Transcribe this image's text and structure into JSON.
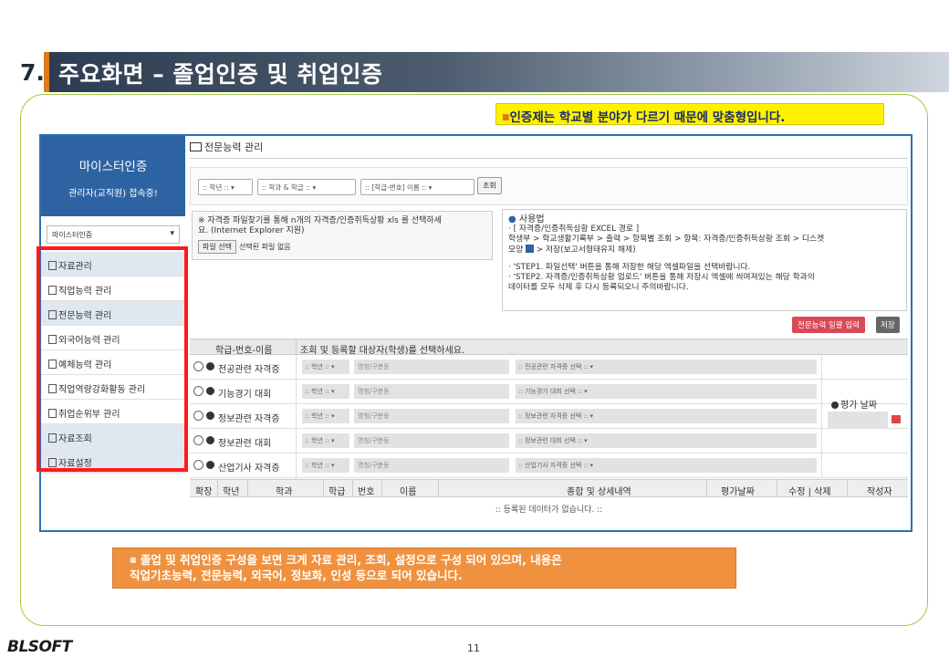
{
  "slide": {
    "number": "7.",
    "title": "주요화면 – 졸업인증 및 취업인증",
    "note_top": "인증제는 학교별 분야가 다르기 때문에 맞춤형입니다.",
    "note_bottom_line1": "졸업 및 취업인증 구성을 보면 크게 자료 관리, 조회, 설정으로 구성 되어 있으며, 내용은",
    "note_bottom_line2": "직업기초능력, 전문능력, 외국어, 정보화, 인성 등으로 되어 있습니다.",
    "logo_a": "BL",
    "logo_b": "SOFT",
    "page": "11"
  },
  "sidebar": {
    "title": "마이스터인증",
    "subtitle": "관리자(교직원) 접속중!",
    "select_value": "마이스터인증",
    "items": [
      {
        "label": "자료관리"
      },
      {
        "label": "직업능력 관리"
      },
      {
        "label": "전문능력 관리"
      },
      {
        "label": "외국어능력 관리"
      },
      {
        "label": "예체능력 관리"
      },
      {
        "label": "직업역량강화활동 관리"
      },
      {
        "label": "취업순위부 관리"
      },
      {
        "label": "자료조회"
      },
      {
        "label": "자료설정"
      }
    ]
  },
  "content": {
    "title": "전문능력 관리",
    "filter_year": ":: 학년 :: ▾",
    "filter_dept": ":: 학과 & 학급 ::  ▾",
    "filter_name": ":: [학급-번호] 이름 ::  ▾",
    "search_button": "조회",
    "upload_text1": "※ 자격증 파일찾기를 통해 n개의 자격증/인증취득상황 xls 를 선택하세",
    "upload_text2": "요. (Internet Explorer 지원)",
    "file_button": "파일 선택",
    "file_status": "선택된 파일 없음",
    "usage": {
      "heading": "사용법",
      "l1": "· [ 자격증/인증취득상황 EXCEL 경로 ]",
      "l2": "  학생부 > 학교생활기록부 > 출력 > 항목별 조회 > 항목: 자격증/인증취득상황 조회 > 디스켓",
      "l3a": "모양 ",
      "l3b": " > 저장(보고서형태유지 해제)",
      "l4": "· 'STEP1. 파일선택' 버튼을 통해 저장한 해당 엑셀파일을 선택바랍니다.",
      "l5": "· 'STEP2. 자격증/인증취득상황 업로드' 버튼을 통해 저장시 엑셀에 씌여져있는 해당 학과의",
      "l6": "데이터를 모두 삭제 후 다시 등록되오니 주의바랍니다."
    },
    "btn_bulk": "전문능력 일괄 입력",
    "btn_save": "저장",
    "table_head_1": "학급-번호-이름",
    "table_head_2": "조회 및 등록할 대상자(학생)를 선택하세요.",
    "rows": [
      {
        "label": "전공관련 자격증",
        "sel1": ":: 학년 ::  ▾",
        "sel2": "명칭/구분등",
        "sel3": ":: 전공관련 자격증 선택 ::  ▾"
      },
      {
        "label": "기능경기 대회",
        "sel1": ":: 학년 ::  ▾",
        "sel2": "명칭/구분등",
        "sel3": ":: 기능경기 대회 선택 ::  ▾"
      },
      {
        "label": "정보관련 자격증",
        "sel1": ":: 학년 ::  ▾",
        "sel2": "명칭/구분등",
        "sel3": ":: 정보관련 자격증 선택 ::  ▾"
      },
      {
        "label": "정보관련 대회",
        "sel1": ":: 학년 ::  ▾",
        "sel2": "명칭/구분등",
        "sel3": ":: 정보관련 대회 선택 ::  ▾"
      },
      {
        "label": "산업기사 자격증",
        "sel1": ":: 학년 ::  ▾",
        "sel2": "명칭/구분등",
        "sel3": ":: 산업기사 자격증 선택 ::  ▾"
      }
    ],
    "eval_date_label": "평가 날짜",
    "list_headers": [
      "확장",
      "학년",
      "학과",
      "학급",
      "번호",
      "이름",
      "종합 및 상세내역",
      "평가날짜",
      "수정 | 삭제",
      "작성자"
    ],
    "empty_text": ":: 등록된 데이터가 없습니다. ::"
  },
  "colors": {
    "accent_orange": "#f0913f",
    "note_yellow": "#fff200",
    "sidebar_blue": "#2e63a3",
    "highlight_red": "#ff1a1a",
    "frame_green": "#a6c93f"
  }
}
